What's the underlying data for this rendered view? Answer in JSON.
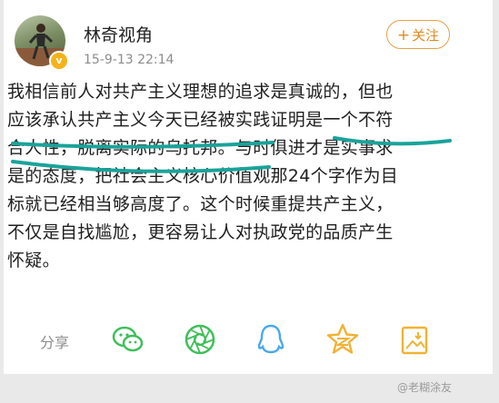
{
  "post": {
    "username": "林奇视角",
    "timestamp": "15-9-13 22:14",
    "follow_label": "关注",
    "body": "我相信前人对共产主义理想的追求是真诚的，但也\n应该承认共产主义今天已经被实践证明是一个不符\n合人性，脱离实际的乌托邦。与时俱进才是实事求\n是的态度，把社会主义核心价值观那24个字作为目\n标就已经相当够高度了。这个时候重提共产主义，\n不仅是自找尴尬，更容易让人对执政党的品质产生\n怀疑。"
  },
  "share": {
    "label": "分享",
    "icons": [
      "wechat-icon",
      "moments-icon",
      "qq-icon",
      "qzone-icon",
      "save-image-icon"
    ]
  },
  "watermark": "@老糊涂友",
  "colors": {
    "accent_orange": "#e08a1e",
    "share_icon_green": "#3fbf5a",
    "share_icon_blue": "#4aa8ea",
    "share_icon_yellow": "#f2b233",
    "highlight_teal": "#1aa39a"
  }
}
